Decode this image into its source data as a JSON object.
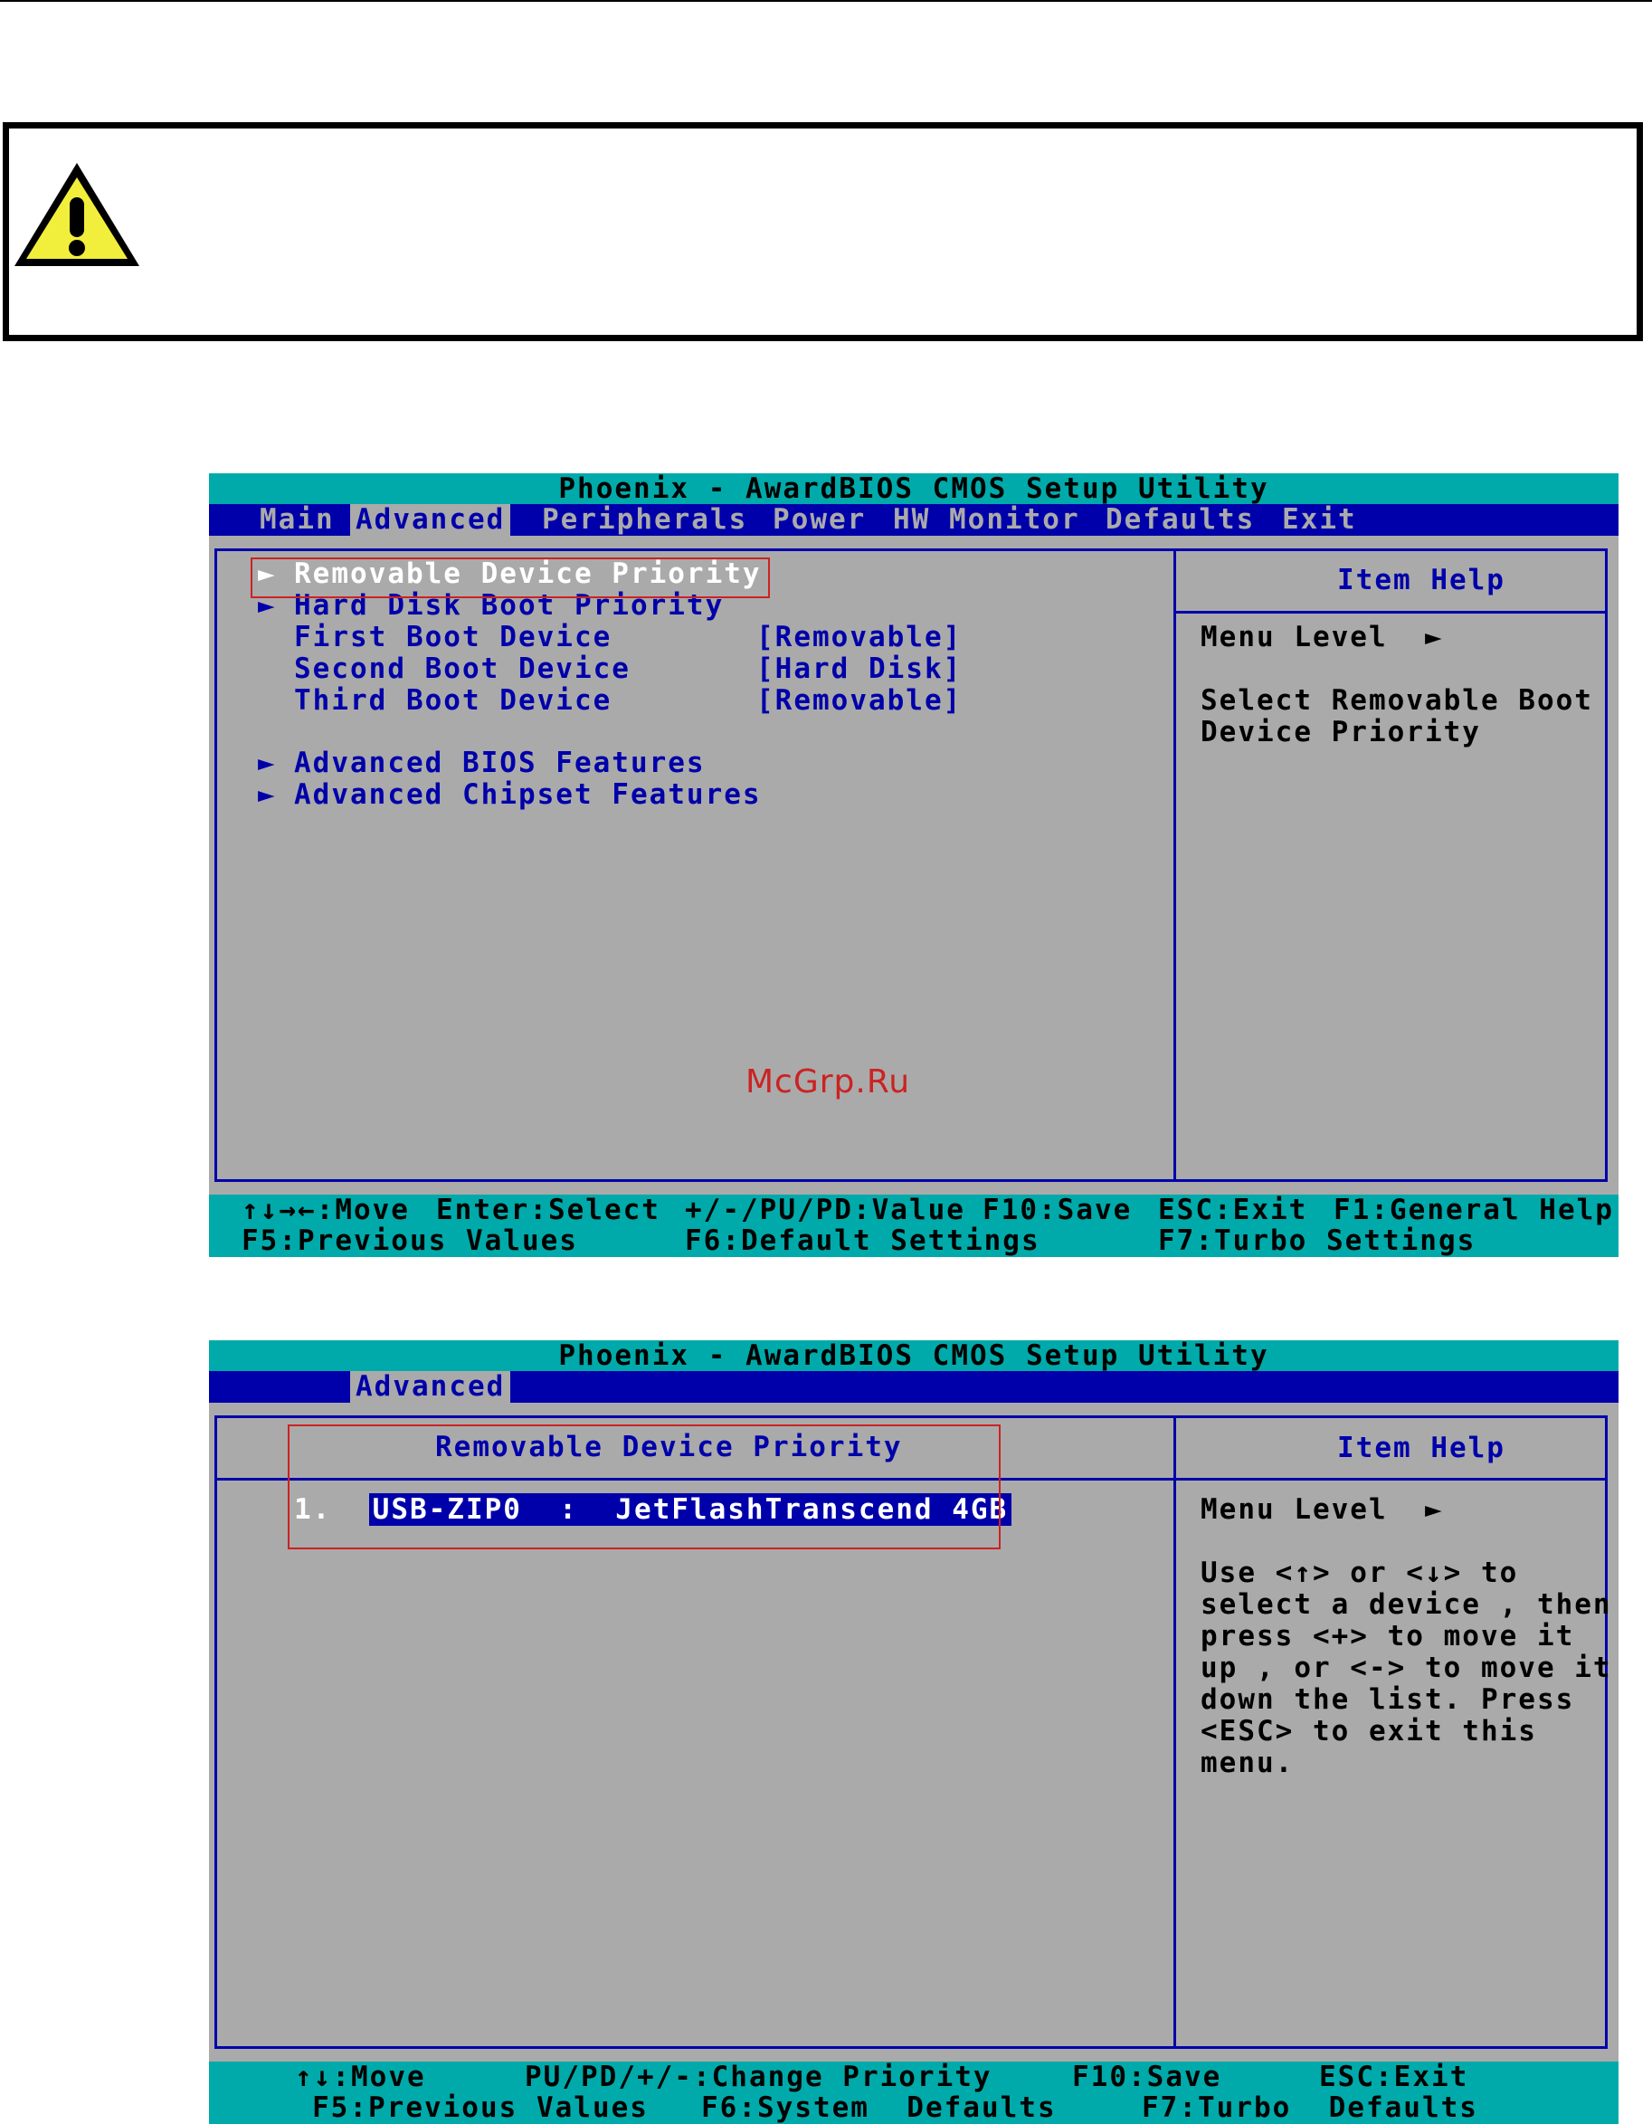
{
  "bios1": {
    "title": "Phoenix - AwardBIOS CMOS Setup Utility",
    "menu": [
      "Main",
      "Advanced",
      "Peripherals",
      "Power",
      "HW Monitor",
      "Defaults",
      "Exit"
    ],
    "items": [
      {
        "label": "Removable Device Priority",
        "value": ""
      },
      {
        "label": "Hard Disk Boot Priority",
        "value": ""
      },
      {
        "label": "First Boot Device",
        "value": "[Removable]"
      },
      {
        "label": "Second Boot Device",
        "value": "[Hard Disk]"
      },
      {
        "label": "Third Boot Device",
        "value": "[Removable]"
      },
      {
        "label": "Advanced BIOS Features",
        "value": ""
      },
      {
        "label": "Advanced Chipset Features",
        "value": ""
      }
    ],
    "help_title": "Item Help",
    "menu_level": "Menu Level",
    "help_text": "Select Removable Boot\nDevice Priority",
    "watermark": "McGrp.Ru",
    "status": {
      "move": "↑↓→←:Move",
      "enter": "Enter:Select",
      "value": "+/-/PU/PD:Value",
      "f10": "F10:Save",
      "esc": "ESC:Exit",
      "f1": "F1:General Help",
      "f5": "F5:Previous Values",
      "f6": "F6:Default Settings",
      "f7": "F7:Turbo Settings"
    }
  },
  "bios2": {
    "title": "Phoenix - AwardBIOS CMOS Setup Utility",
    "menu_active": "Advanced",
    "section_title": "Removable Device Priority",
    "device_index": "1.",
    "device": "USB-ZIP0  :  JetFlashTranscend 4GB",
    "help_title": "Item Help",
    "menu_level": "Menu Level",
    "help_text": "Use <↑> or <↓> to\nselect a device , then\npress <+> to move it\nup , or <-> to move it\ndown the list. Press\n<ESC> to exit this\nmenu.",
    "status": {
      "move": "↑↓:Move",
      "change": "PU/PD/+/-:Change Priority",
      "f10": "F10:Save",
      "esc": "ESC:Exit",
      "f5": "F5:Previous Values",
      "f6": "F6:System  Defaults",
      "f7": "F7:Turbo  Defaults"
    }
  },
  "colors": {
    "bios_gray": "#aaaaaa",
    "bios_blue": "#0000aa",
    "bios_cyan": "#00aaaa",
    "highlight_red": "#cc2222",
    "warning_yellow": "#f2ef3c"
  },
  "icons": {
    "warning": "warning-triangle-icon",
    "submenu": "submenu-arrow-icon"
  }
}
